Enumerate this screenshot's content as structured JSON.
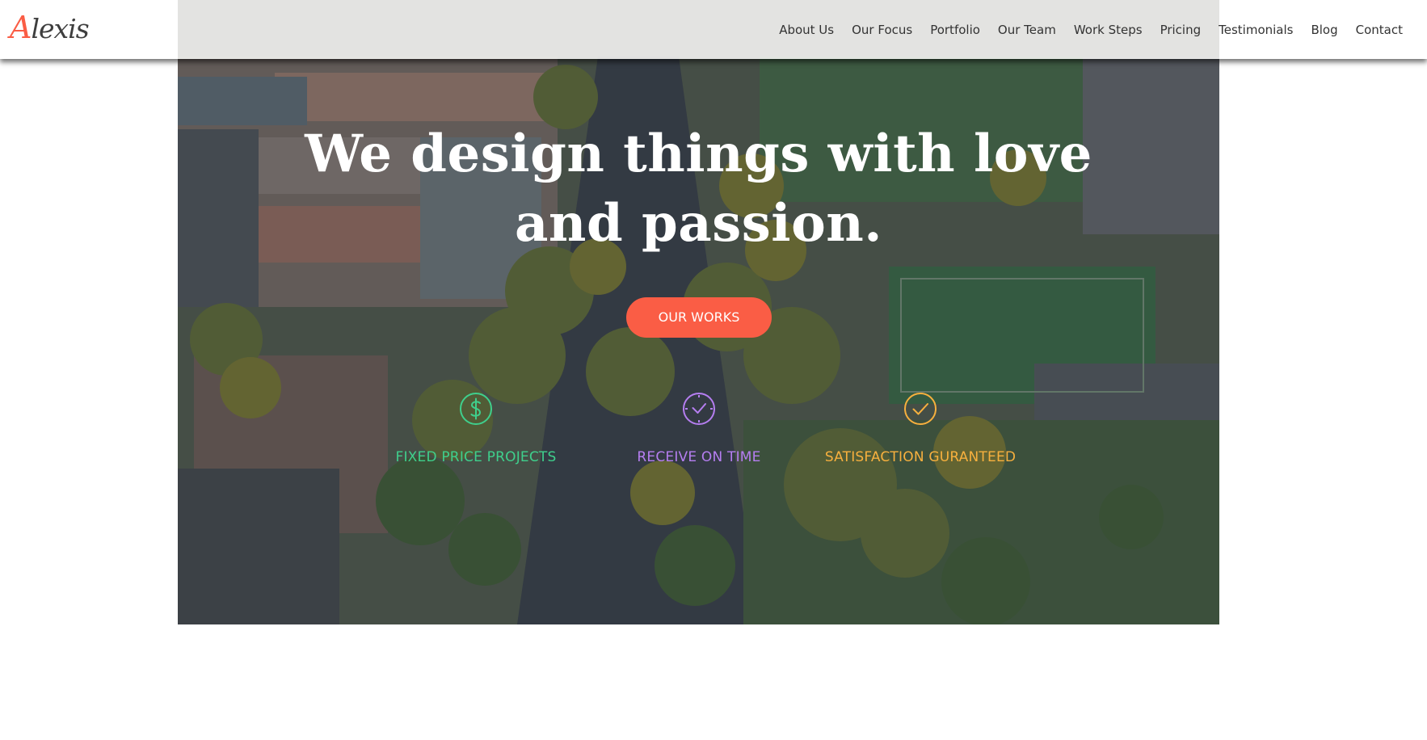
{
  "brand": {
    "logo_first_letter": "A",
    "logo_rest": "lexis",
    "accent_color": "#fa5d45"
  },
  "nav": {
    "items": [
      {
        "label": "About Us"
      },
      {
        "label": "Our Focus"
      },
      {
        "label": "Portfolio"
      },
      {
        "label": "Our Team"
      },
      {
        "label": "Work Steps"
      },
      {
        "label": "Pricing"
      },
      {
        "label": "Testimonials"
      },
      {
        "label": "Blog"
      },
      {
        "label": "Contact"
      }
    ]
  },
  "hero": {
    "headline_line1": "We design things with love",
    "headline_line2": "and passion.",
    "cta_label": "OUR WORKS",
    "cta_color": "#fa5d45",
    "features": [
      {
        "icon": "dollar-circle-icon",
        "label": "FIXED PRICE PROJECTS",
        "color": "#3fcf8c"
      },
      {
        "icon": "clock-check-icon",
        "label": "RECEIVE ON TIME",
        "color": "#b57ef0"
      },
      {
        "icon": "checkmark-circle-icon",
        "label": "SATISFACTION GURANTEED",
        "color": "#f7b03e"
      }
    ]
  }
}
